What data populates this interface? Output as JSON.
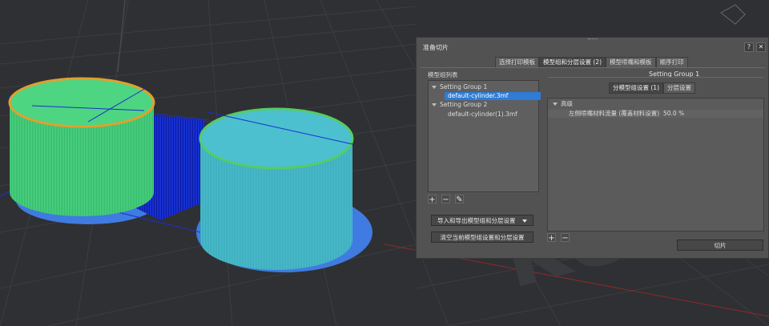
{
  "dialog": {
    "title": "准备切片",
    "help_label": "?",
    "close_label": "✕",
    "tabs": [
      {
        "label": "选择打印模板",
        "active": false
      },
      {
        "label": "模型组和分层设置 (2)",
        "active": true
      },
      {
        "label": "模型喷嘴和模板",
        "active": false
      },
      {
        "label": "顺序打印",
        "active": false
      }
    ],
    "left": {
      "group_label": "模型组列表",
      "tree": [
        {
          "label": "Setting Group 1",
          "type": "group"
        },
        {
          "label": "default-cylinder.3mf",
          "type": "item",
          "selected": true
        },
        {
          "label": "Setting Group 2",
          "type": "group"
        },
        {
          "label": "default-cylinder(1).3mf",
          "type": "item",
          "selected": false
        }
      ],
      "add_label": "+",
      "remove_label": "−",
      "edit_label": "✎",
      "import_export_label": "导入和导出模型组和分层设置",
      "clear_label": "清空当前模型组设置和分层设置"
    },
    "right": {
      "group_title": "Setting Group 1",
      "tabs": [
        {
          "label": "分模型组设置 (1)",
          "active": true
        },
        {
          "label": "分层设置",
          "active": false
        }
      ],
      "section_label": "高级",
      "params": [
        {
          "name": "左侧喷嘴材料流量 (覆盖材料设置)",
          "value": "50.0 %"
        }
      ],
      "add_label": "+",
      "remove_label": "−",
      "slice_label": "切片"
    }
  },
  "colors": {
    "accent": "#2f7bd5",
    "panel": "#525252"
  }
}
